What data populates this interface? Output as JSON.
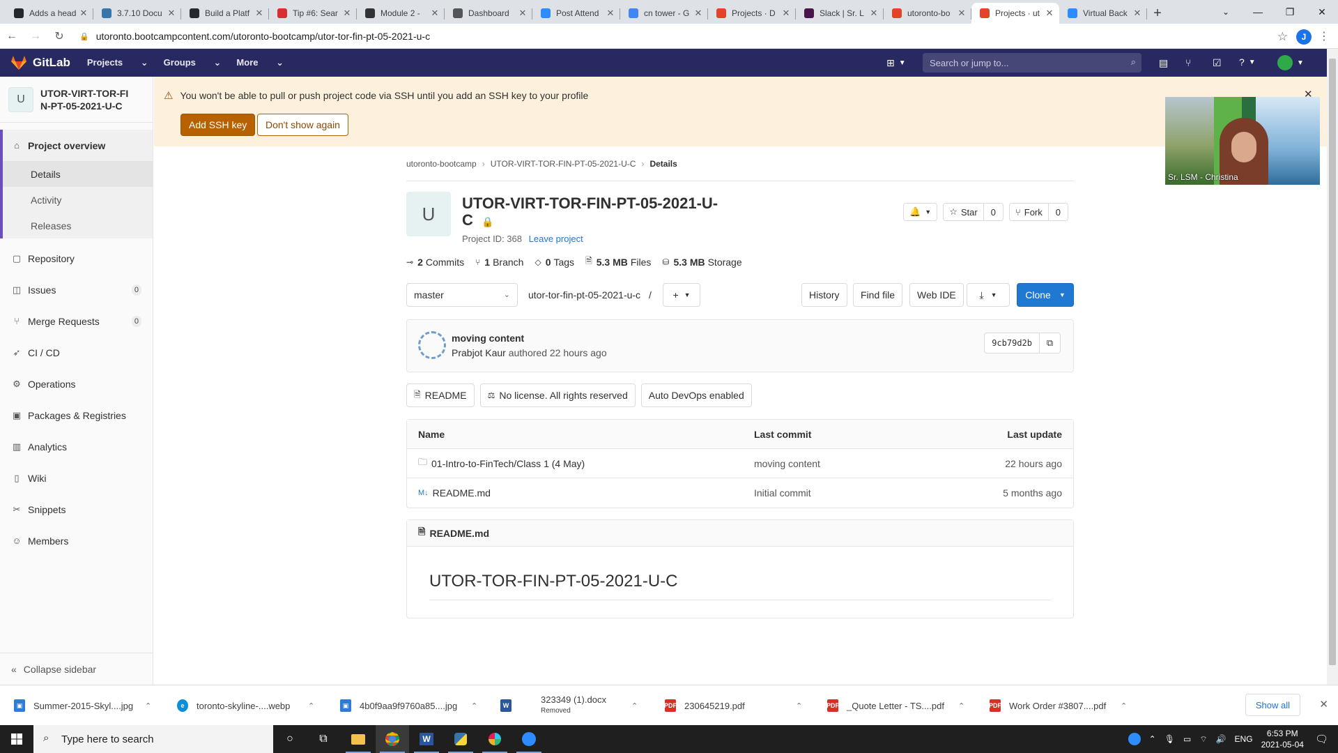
{
  "browser": {
    "tabs": [
      {
        "label": "Adds a head",
        "favicon_color": "#24292e",
        "favicon_glyph": "github-icon"
      },
      {
        "label": "3.7.10 Docu",
        "favicon_color": "#3776ab",
        "favicon_glyph": "python-icon"
      },
      {
        "label": "Build a Platf",
        "favicon_color": "#24292e",
        "favicon_glyph": "github-icon"
      },
      {
        "label": "Tip #6: Sear",
        "favicon_color": "#d63031",
        "favicon_glyph": "tip-icon"
      },
      {
        "label": "Module 2 -",
        "favicon_color": "#333333",
        "favicon_glyph": "book-icon"
      },
      {
        "label": "Dashboard",
        "favicon_color": "#555555",
        "favicon_glyph": "globe-icon"
      },
      {
        "label": "Post Attend",
        "favicon_color": "#2d8cff",
        "favicon_glyph": "zoom-icon"
      },
      {
        "label": "cn tower - G",
        "favicon_color": "#4285f4",
        "favicon_glyph": "google-icon"
      },
      {
        "label": "Projects · D",
        "favicon_color": "#e24329",
        "favicon_glyph": "gitlab-icon"
      },
      {
        "label": "Slack | Sr. L",
        "favicon_color": "#4a154b",
        "favicon_glyph": "slack-icon"
      },
      {
        "label": "utoronto-bo",
        "favicon_color": "#e24329",
        "favicon_glyph": "gitlab-icon"
      },
      {
        "label": "Projects · ut",
        "favicon_color": "#e24329",
        "favicon_glyph": "gitlab-icon",
        "active": true
      },
      {
        "label": "Virtual Back",
        "favicon_color": "#2d8cff",
        "favicon_glyph": "zoom-icon"
      }
    ],
    "url": "utoronto.bootcampcontent.com/utoronto-bootcamp/utor-tor-fin-pt-05-2021-u-c",
    "profile_initial": "J"
  },
  "gitlab": {
    "brand": "GitLab",
    "nav": [
      "Projects",
      "Groups",
      "More"
    ],
    "search_placeholder": "Search or jump to..."
  },
  "sidebar": {
    "project_initial": "U",
    "project_name": "UTOR-VIRT-TOR-FIN-PT-05-2021-U-C",
    "overview_label": "Project overview",
    "sub_items": [
      "Details",
      "Activity",
      "Releases"
    ],
    "items": [
      {
        "label": "Repository",
        "icon": "repository-icon"
      },
      {
        "label": "Issues",
        "icon": "issues-icon",
        "badge": "0"
      },
      {
        "label": "Merge Requests",
        "icon": "merge-request-icon",
        "badge": "0"
      },
      {
        "label": "CI / CD",
        "icon": "rocket-icon"
      },
      {
        "label": "Operations",
        "icon": "operations-icon"
      },
      {
        "label": "Packages & Registries",
        "icon": "package-icon"
      },
      {
        "label": "Analytics",
        "icon": "analytics-icon"
      },
      {
        "label": "Wiki",
        "icon": "wiki-icon"
      },
      {
        "label": "Snippets",
        "icon": "snippets-icon"
      },
      {
        "label": "Members",
        "icon": "members-icon"
      }
    ],
    "collapse_label": "Collapse sidebar"
  },
  "alert": {
    "message": "You won't be able to pull or push project code via SSH until you add an SSH key to your profile",
    "primary_button": "Add SSH key",
    "secondary_button": "Don't show again"
  },
  "breadcrumb": [
    "utoronto-bootcamp",
    "UTOR-VIRT-TOR-FIN-PT-05-2021-U-C",
    "Details"
  ],
  "project": {
    "initial": "U",
    "title": "UTOR-VIRT-TOR-FIN-PT-05-2021-U-C",
    "id_text": "Project ID: 368",
    "leave_label": "Leave project",
    "star_label": "Star",
    "star_count": "0",
    "fork_label": "Fork",
    "fork_count": "0"
  },
  "stats": [
    {
      "value": "2",
      "label": "Commits",
      "icon": "commit-icon"
    },
    {
      "value": "1",
      "label": "Branch",
      "icon": "branch-icon"
    },
    {
      "value": "0",
      "label": "Tags",
      "icon": "tag-icon"
    },
    {
      "value": "5.3 MB",
      "label": "Files",
      "icon": "file-icon"
    },
    {
      "value": "5.3 MB",
      "label": "Storage",
      "icon": "storage-icon"
    }
  ],
  "toolbar": {
    "branch": "master",
    "path": "utor-tor-fin-pt-05-2021-u-c",
    "path_sep": "/",
    "history": "History",
    "find_file": "Find file",
    "web_ide": "Web IDE",
    "clone": "Clone"
  },
  "last_commit": {
    "title": "moving content",
    "author": "Prabjot Kaur",
    "authored": "authored 22 hours ago",
    "sha": "9cb79d2b"
  },
  "badges": [
    {
      "label": "README",
      "icon": "doc-icon"
    },
    {
      "label": "No license. All rights reserved",
      "icon": "scale-icon"
    },
    {
      "label": "Auto DevOps enabled",
      "icon": ""
    }
  ],
  "files": {
    "headers": [
      "Name",
      "Last commit",
      "Last update"
    ],
    "rows": [
      {
        "name": "01-Intro-to-FinTech/Class 1 (4 May)",
        "type": "folder",
        "commit": "moving content",
        "updated": "22 hours ago"
      },
      {
        "name": "README.md",
        "type": "markdown",
        "commit": "Initial commit",
        "updated": "5 months ago"
      }
    ]
  },
  "readme": {
    "filename": "README.md",
    "heading": "UTOR-TOR-FIN-PT-05-2021-U-C"
  },
  "video": {
    "participant": "Sr. LSM - Christina"
  },
  "downloads": [
    {
      "name": "Summer-2015-Skyl....jpg",
      "type": "image",
      "color": "#2f7bd6"
    },
    {
      "name": "toronto-skyline-....webp",
      "type": "edge",
      "color": "#0c8ed9"
    },
    {
      "name": "4b0f9aa9f9760a85....jpg",
      "type": "image",
      "color": "#2f7bd6"
    },
    {
      "name": "323349 (1).docx",
      "sub": "Removed",
      "type": "word",
      "color": "#2b579a"
    },
    {
      "name": "230645219.pdf",
      "type": "pdf",
      "color": "#d93025"
    },
    {
      "name": "_Quote Letter - TS....pdf",
      "type": "pdf",
      "color": "#d93025"
    },
    {
      "name": "Work Order #3807....pdf",
      "type": "pdf",
      "color": "#d93025"
    }
  ],
  "downloads_show_all": "Show all",
  "taskbar": {
    "search_placeholder": "Type here to search",
    "lang": "ENG",
    "time": "6:53 PM",
    "date": "2021-05-04"
  }
}
